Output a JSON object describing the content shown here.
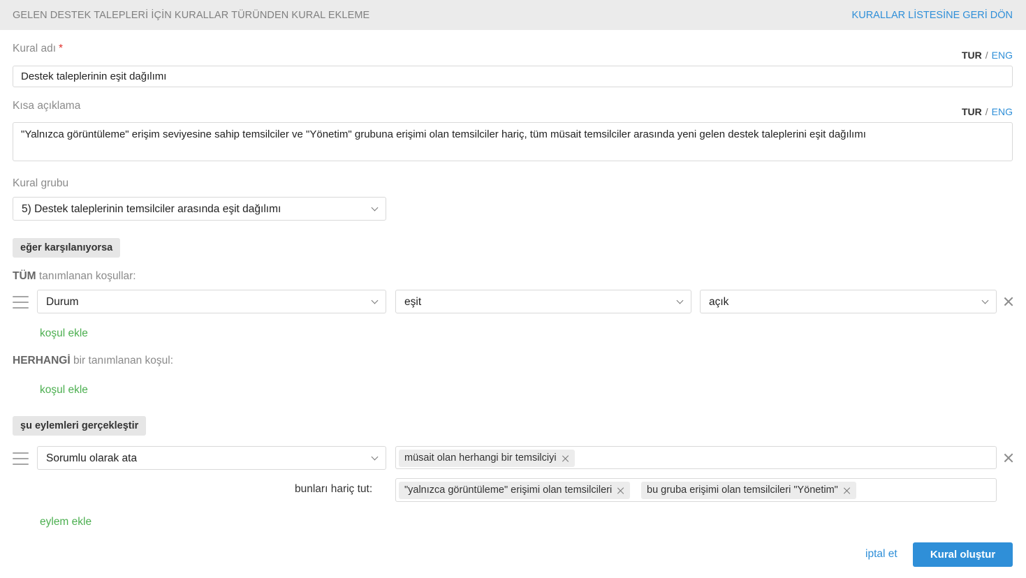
{
  "header": {
    "title": "GELEN DESTEK TALEPLERİ İÇİN KURALLAR TÜRÜNDEN KURAL EKLEME",
    "back_link": "KURALLAR LİSTESİNE GERİ DÖN"
  },
  "lang": {
    "tur": "TUR",
    "sep": "/",
    "eng": "ENG"
  },
  "rule_name": {
    "label": "Kural adı",
    "required_mark": "*",
    "value": "Destek taleplerinin eşit dağılımı"
  },
  "short_desc": {
    "label": "Kısa açıklama",
    "value": "\"Yalnızca görüntüleme\" erişim seviyesine sahip temsilciler ve \"Yönetim\" grubuna erişimi olan temsilciler hariç, tüm müsait temsilciler arasında yeni gelen destek taleplerini eşit dağılımı"
  },
  "rule_group": {
    "label": "Kural grubu",
    "value": "5) Destek taleplerinin temsilciler arasında eşit dağılımı"
  },
  "conditions": {
    "section_label": "eğer karşılanıyorsa",
    "all": {
      "strong": "TÜM",
      "rest": "tanımlanan koşullar:",
      "row": {
        "field": "Durum",
        "operator": "eşit",
        "value": "açık"
      },
      "add_label": "koşul ekle"
    },
    "any": {
      "strong": "HERHANGİ",
      "rest": "bir tanımlanan koşul:",
      "add_label": "koşul ekle"
    }
  },
  "actions": {
    "section_label": "şu eylemleri gerçekleştir",
    "row": {
      "action": "Sorumlu olarak ata",
      "targets": [
        "müsait olan herhangi bir temsilciyi"
      ],
      "exclude_label": "bunları hariç tut:",
      "excludes": [
        "\"yalnızca görüntüleme\" erişimi olan temsilcileri",
        "bu gruba erişimi olan temsilcileri \"Yönetim\""
      ]
    },
    "add_label": "eylem ekle"
  },
  "footer": {
    "cancel": "iptal et",
    "submit": "Kural oluştur"
  }
}
